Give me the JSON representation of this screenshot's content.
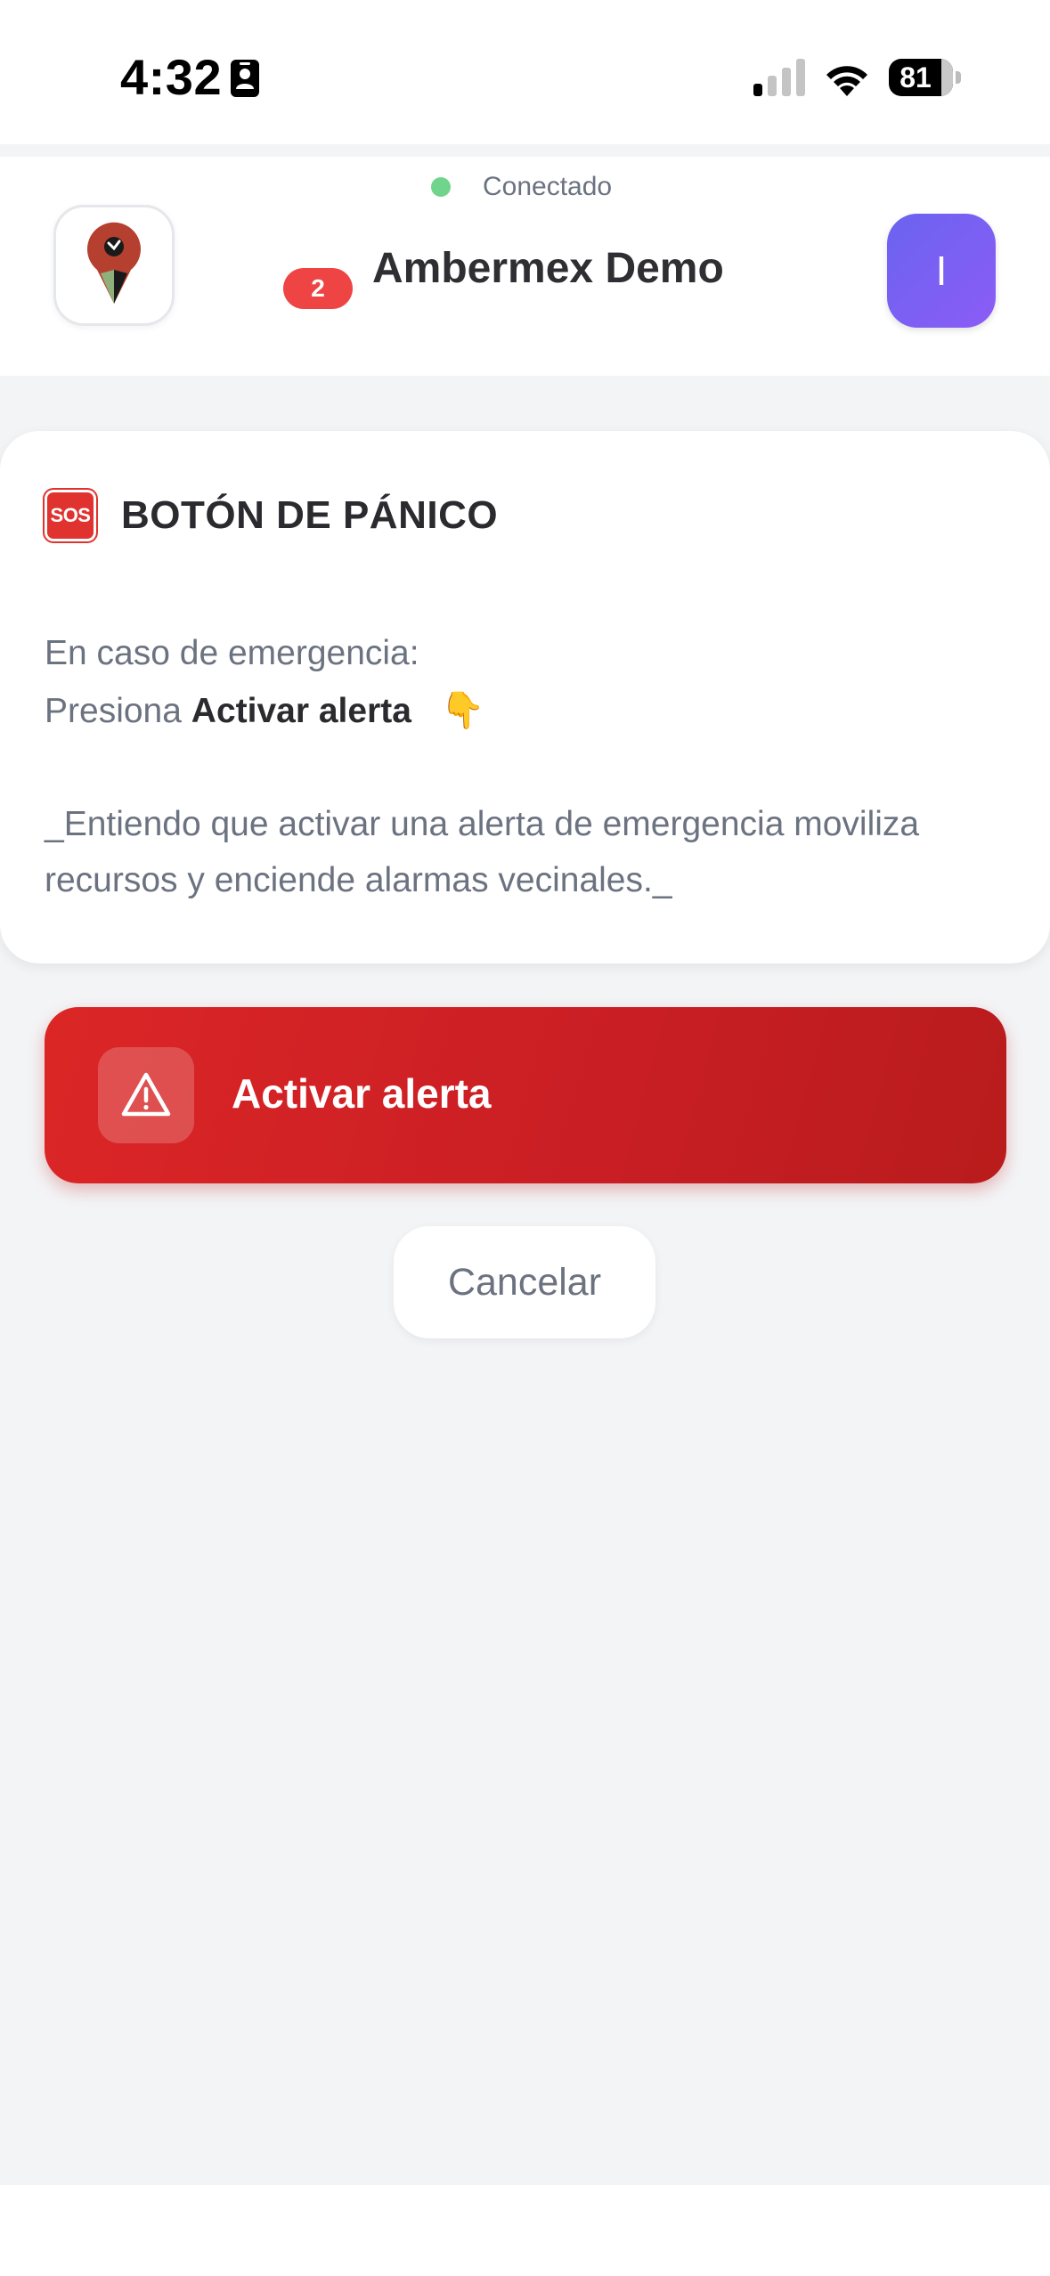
{
  "status_bar": {
    "time": "4:32",
    "battery": "81",
    "icons": [
      "contact-card-icon",
      "cellular-signal-icon",
      "wifi-icon",
      "battery-icon"
    ]
  },
  "header": {
    "connection_status": "Conectado",
    "connection_color": "#6fd48c",
    "notification_count": "2",
    "organization_name": "Ambermex Demo",
    "avatar_initial": "I",
    "avatar_color": "#7c5cf4"
  },
  "panic_card": {
    "icon_label": "SOS",
    "title": "BOTÓN DE PÁNICO",
    "instruction_line1": "En caso de emergencia:",
    "instruction_prefix": "Presiona",
    "instruction_action": "Activar alerta",
    "instruction_emoji": "👇",
    "disclaimer": "_Entiendo que activar una alerta de emergencia moviliza recursos y enciende alarmas vecinales._"
  },
  "actions": {
    "activate_label": "Activar alerta",
    "activate_color": "#dc2626",
    "cancel_label": "Cancelar"
  }
}
